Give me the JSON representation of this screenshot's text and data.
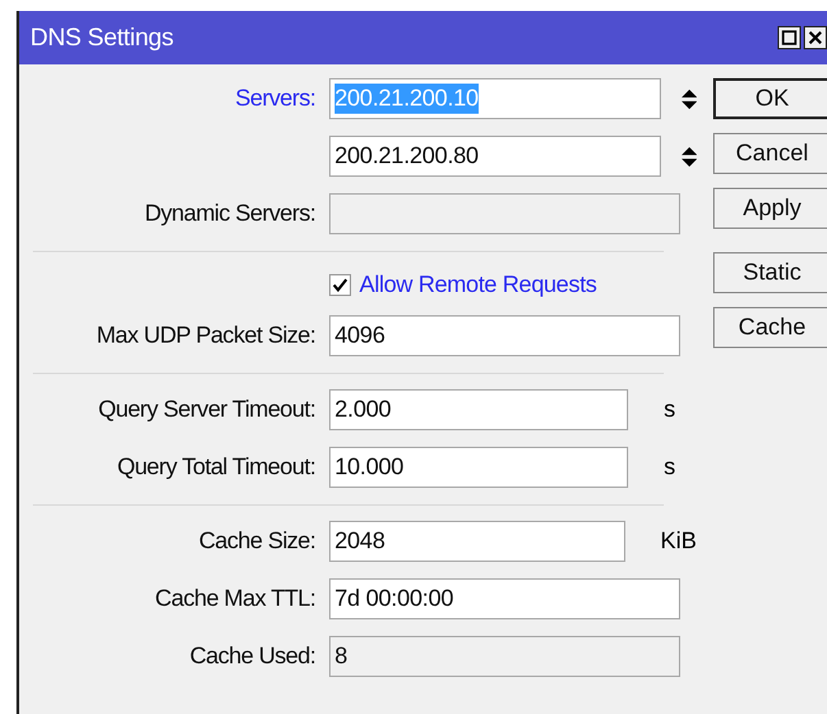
{
  "window": {
    "title": "DNS Settings"
  },
  "rows": [
    {
      "kind": "field",
      "label": "Servers:",
      "highlighted": true,
      "value": "200.21.200.10",
      "selected": true,
      "arrows": true,
      "disabled": false
    },
    {
      "kind": "field",
      "value": "200.21.200.80",
      "selected": false,
      "arrows": true,
      "disabled": false
    },
    {
      "kind": "field",
      "label": "Dynamic Servers:",
      "highlighted": false,
      "arrows": false,
      "disabled": true
    },
    {
      "kind": "separator"
    },
    {
      "kind": "checkbox",
      "label": "Allow Remote Requests",
      "checked": true
    },
    {
      "kind": "field",
      "label": "Max UDP Packet Size:",
      "highlighted": false,
      "value": "4096",
      "selected": false,
      "arrows": false,
      "disabled": false
    },
    {
      "kind": "separator"
    },
    {
      "kind": "field",
      "label": "Query Server Timeout:",
      "highlighted": false,
      "value": "2.000",
      "unit": "s",
      "selected": false,
      "arrows": false,
      "disabled": false
    },
    {
      "kind": "field",
      "label": "Query Total Timeout:",
      "highlighted": false,
      "value": "10.000",
      "unit": "s",
      "selected": false,
      "arrows": false,
      "disabled": false
    },
    {
      "kind": "separator"
    },
    {
      "kind": "field",
      "label": "Cache Size:",
      "highlighted": false,
      "value": "2048",
      "unit": "KiB",
      "selected": false,
      "arrows": false,
      "disabled": false
    },
    {
      "kind": "field",
      "label": "Cache Max TTL:",
      "highlighted": false,
      "value": "7d 00:00:00",
      "selected": false,
      "arrows": false,
      "disabled": false
    },
    {
      "kind": "field",
      "label": "Cache Used:",
      "highlighted": false,
      "value": "8",
      "selected": false,
      "arrows": false,
      "disabled": true
    }
  ],
  "buttons": [
    {
      "label": "OK",
      "default": true
    },
    {
      "label": "Cancel",
      "default": false
    },
    {
      "label": "Apply",
      "default": false
    },
    {
      "label": "Static",
      "default": false
    },
    {
      "label": "Cache",
      "default": false
    }
  ]
}
